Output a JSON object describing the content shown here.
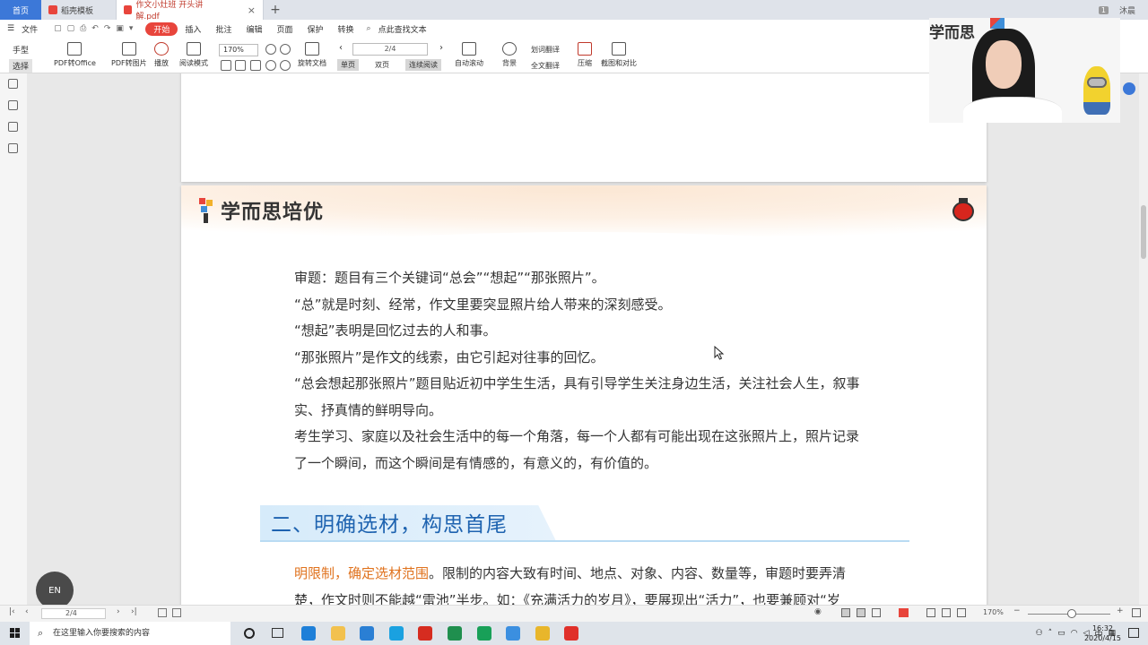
{
  "tabs": {
    "home": "首页",
    "items": [
      {
        "label": "稻壳模板",
        "color": "#e8453c"
      },
      {
        "label": "作文小灶班 开头讲解.pdf",
        "color": "#e8453c"
      }
    ],
    "right_badge": "1",
    "right_user": "沐晨"
  },
  "menu": {
    "file": "文件",
    "items": [
      "开始",
      "插入",
      "批注",
      "编辑",
      "页面",
      "保护",
      "转换"
    ],
    "search": "点此查找文本"
  },
  "toolbar": {
    "hand": "手型",
    "select": "选择",
    "pdf_office": "PDF转Office",
    "pdf_image": "PDF转图片",
    "play": "播放",
    "read_mode": "阅读模式",
    "zoom": "170%",
    "rotate": "旋转文档",
    "page": "2/4",
    "single": "单页",
    "double": "双页",
    "continuous": "连续阅读",
    "auto_scroll": "自动滚动",
    "background": "背景",
    "word_translate": "划词翻译",
    "full_translate": "全文翻译",
    "compress": "压缩",
    "screenshot": "截图和对比"
  },
  "document": {
    "logo_text": "学而思培优",
    "paragraphs": [
      "审题：题目有三个关键词“总会”“想起”“那张照片”。",
      "“总”就是时刻、经常，作文里要突显照片给人带来的深刻感受。",
      "“想起”表明是回忆过去的人和事。",
      "“那张照片”是作文的线索，由它引起对往事的回忆。",
      "“总会想起那张照片”题目贴近初中学生生活，具有引导学生关注身边生活，关注社会人生，叙事",
      "实、抒真情的鲜明导向。",
      "考生学习、家庭以及社会生活中的每一个角落，每一个人都有可能出现在这张照片上，照片记录",
      "了一个瞬间，而这个瞬间是有情感的，有意义的，有价值的。"
    ],
    "heading": "二、明确选材，构思首尾",
    "body_highlight": "明限制，确定选材范围",
    "body_rest": "。限制的内容大致有时间、地点、对象、内容、数量等，审题时要弄清",
    "body_line2": "楚，作文时则不能越“雷池”半步。如：《充满活力的岁月》，要展现出“活力”，也要兼顾对“岁"
  },
  "video": {
    "brand": "学而思"
  },
  "en_float": "EN",
  "status": {
    "page": "2/4",
    "zoom": "170%"
  },
  "taskbar": {
    "search_placeholder": "在这里输入你要搜索的内容",
    "ime": "中",
    "time": "16:32",
    "date": "2020/4/15",
    "apps": [
      {
        "name": "edge",
        "color": "#1e7fd8"
      },
      {
        "name": "folder",
        "color": "#f2c14e"
      },
      {
        "name": "mail",
        "color": "#2a7fd4"
      },
      {
        "name": "l-app",
        "color": "#1aa1e0"
      },
      {
        "name": "wps",
        "color": "#d62c20"
      },
      {
        "name": "excel",
        "color": "#1f8f4e"
      },
      {
        "name": "en",
        "color": "#18a058"
      },
      {
        "name": "folder2",
        "color": "#3b8fe0"
      },
      {
        "name": "xueersi",
        "color": "#e8b62b"
      },
      {
        "name": "netease",
        "color": "#e0302a"
      }
    ]
  }
}
